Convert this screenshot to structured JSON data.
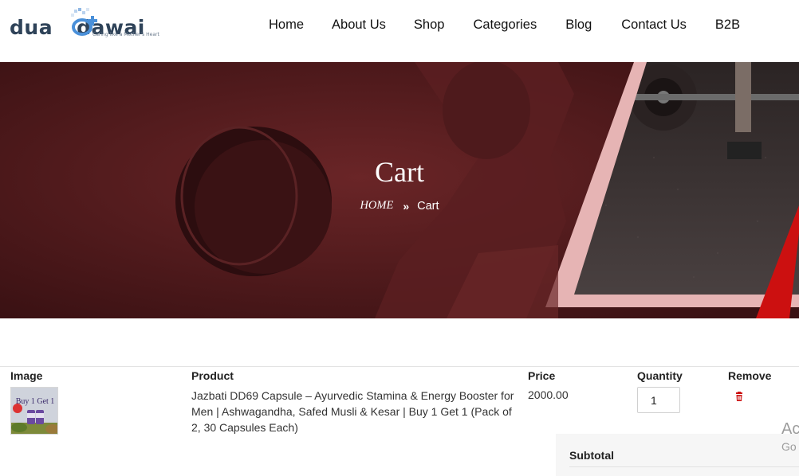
{
  "brand": {
    "name_left": "dua",
    "name_right": "dawai",
    "tagline": "Caring like a Mother's Heart",
    "color": "#2f4359",
    "accent": "#4a90d9"
  },
  "nav": {
    "items": [
      {
        "label": "Home"
      },
      {
        "label": "About Us"
      },
      {
        "label": "Shop"
      },
      {
        "label": "Categories"
      },
      {
        "label": "Blog"
      },
      {
        "label": "Contact Us"
      },
      {
        "label": "B2B"
      }
    ]
  },
  "hero": {
    "title": "Cart",
    "breadcrumb": {
      "home": "HOME",
      "separator_icon": "double-chevron-right-icon",
      "current": "Cart"
    },
    "overlay_color": "#4a1719"
  },
  "cart": {
    "headers": {
      "image": "Image",
      "product": "Product",
      "price": "Price",
      "quantity": "Quantity",
      "remove": "Remove"
    },
    "items": [
      {
        "product_name": "Jazbati DD69 Capsule – Ayurvedic Stamina & Energy Booster for Men | Ashwagandha, Safed Musli & Kesar | Buy 1 Get 1 (Pack of 2, 30 Capsules Each)",
        "price": "2000.00",
        "quantity": "1",
        "thumbnail_text": "Buy 1 Get 1",
        "remove_icon": "trash-icon"
      }
    ],
    "remove_color": "#cc1111"
  },
  "totals": {
    "subtotal_label": "Subtotal"
  },
  "watermark": {
    "line1": "Ac",
    "line2": "Go"
  }
}
